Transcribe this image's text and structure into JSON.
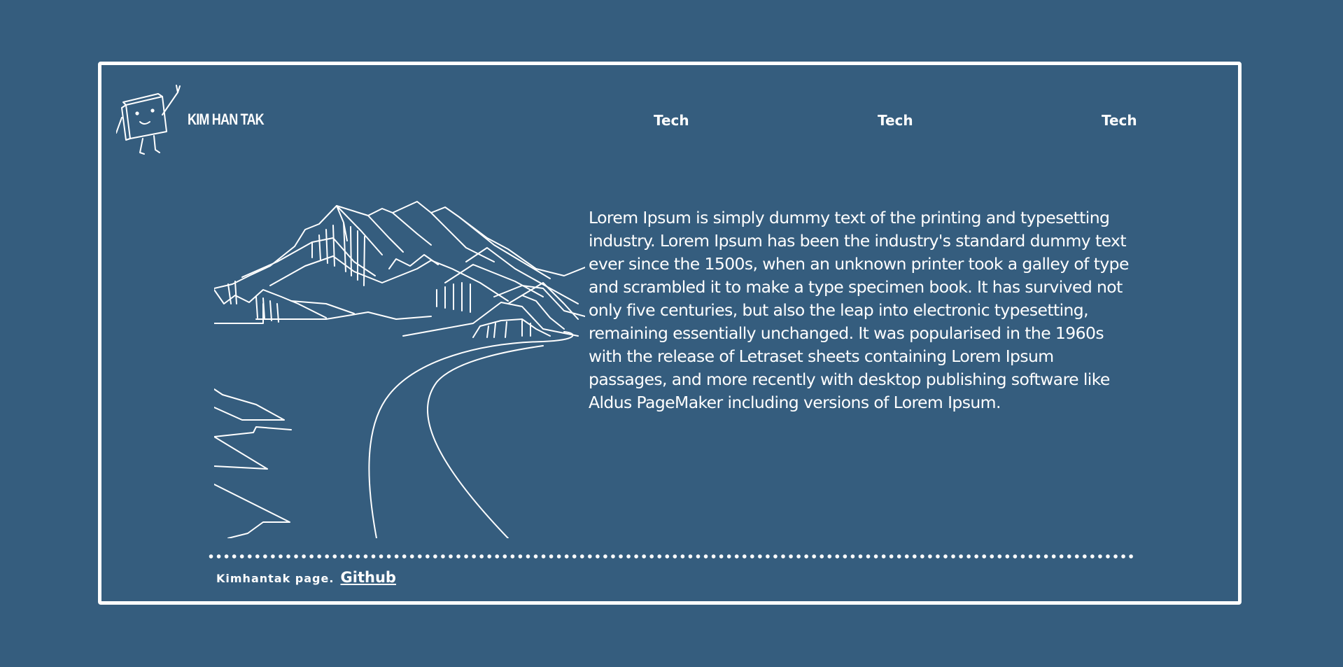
{
  "brand": {
    "name": "KIM HAN TAK",
    "mascot_icon": "book-mascot-waving-icon"
  },
  "nav": {
    "items": [
      {
        "label": "Tech"
      },
      {
        "label": "Tech"
      },
      {
        "label": "Tech"
      }
    ]
  },
  "hero": {
    "illustration_icon": "mountain-landscape-icon",
    "text": "Lorem Ipsum is simply dummy text of the printing and typesetting industry. Lorem Ipsum has been the industry's standard dummy text ever since the 1500s, when an unknown printer took a galley of type and scrambled it to make a type specimen book. It has survived not only five centuries, but also the leap into electronic typesetting, remaining essentially unchanged. It was popularised in the 1960s with the release of Letraset sheets containing Lorem Ipsum passages, and more recently with desktop publishing software like Aldus PageMaker including versions of Lorem Ipsum."
  },
  "footer": {
    "text": "Kimhantak page.",
    "link_label": "Github"
  },
  "colors": {
    "background": "#355d7e",
    "foreground": "#ffffff"
  }
}
